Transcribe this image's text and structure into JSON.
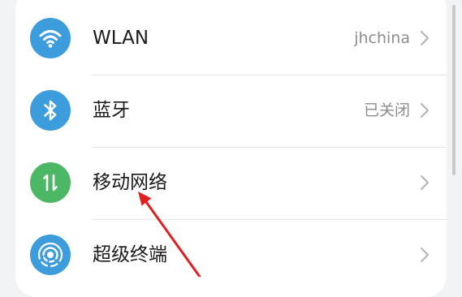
{
  "settings": {
    "items": [
      {
        "label": "WLAN",
        "value": "jhchina",
        "icon": "wifi-icon",
        "icon_color": "#3d9ddc"
      },
      {
        "label": "蓝牙",
        "value": "已关闭",
        "icon": "bluetooth-icon",
        "icon_color": "#3d9ddc"
      },
      {
        "label": "移动网络",
        "value": "",
        "icon": "mobile-data-icon",
        "icon_color": "#4cb866"
      },
      {
        "label": "超级终端",
        "value": "",
        "icon": "super-device-icon",
        "icon_color": "#3d9ddc"
      }
    ]
  },
  "colors": {
    "background": "#f1f3f5",
    "card": "#ffffff",
    "annotation_arrow": "#e02020"
  }
}
